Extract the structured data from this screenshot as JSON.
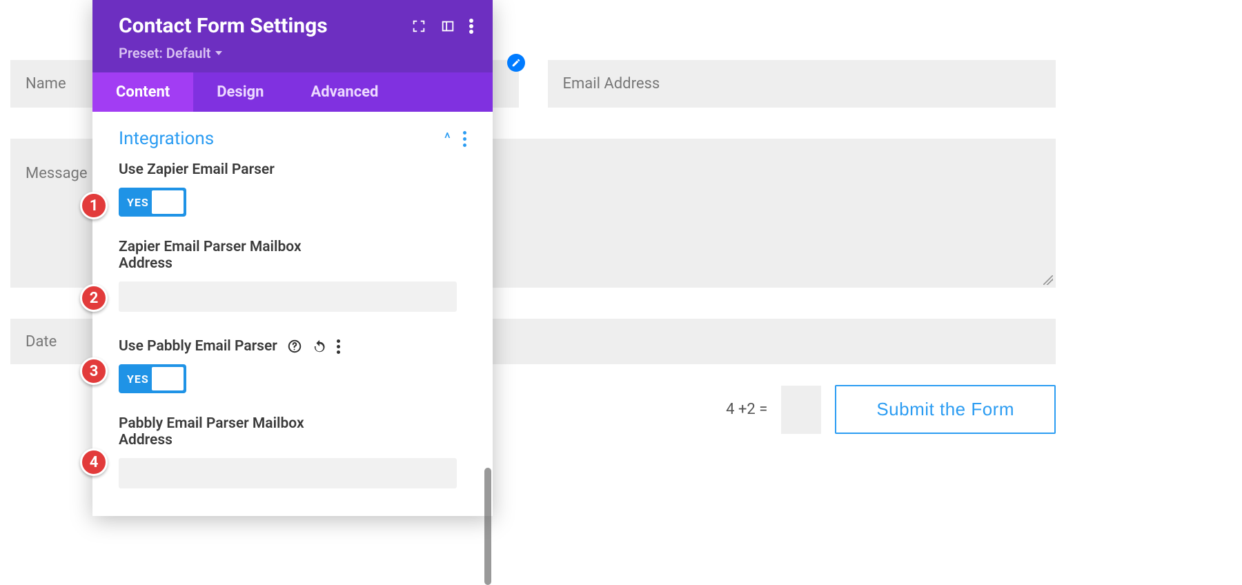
{
  "form": {
    "name_placeholder": "Name",
    "email_placeholder": "Email Address",
    "message_placeholder": "Message",
    "date_placeholder": "Date",
    "captcha_label": "4 +2 =",
    "submit_label": "Submit the Form"
  },
  "panel": {
    "title": "Contact Form Settings",
    "preset_label": "Preset: Default",
    "tabs": {
      "content": "Content",
      "design": "Design",
      "advanced": "Advanced"
    },
    "section_title": "Integrations",
    "toggle_yes": "YES",
    "zapier": {
      "use_label": "Use Zapier Email Parser",
      "mailbox_label": "Zapier Email Parser Mailbox Address"
    },
    "pabbly": {
      "use_label": "Use Pabbly Email Parser",
      "mailbox_label": "Pabbly Email Parser Mailbox Address"
    }
  },
  "badges": {
    "b1": "1",
    "b2": "2",
    "b3": "3",
    "b4": "4"
  }
}
